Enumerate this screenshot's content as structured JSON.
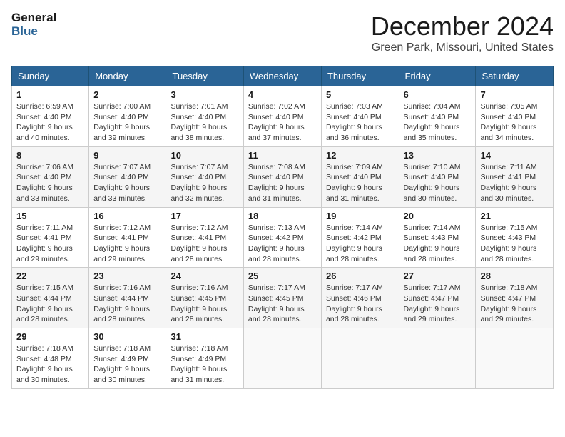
{
  "header": {
    "logo_line1": "General",
    "logo_line2": "Blue",
    "month": "December 2024",
    "location": "Green Park, Missouri, United States"
  },
  "weekdays": [
    "Sunday",
    "Monday",
    "Tuesday",
    "Wednesday",
    "Thursday",
    "Friday",
    "Saturday"
  ],
  "weeks": [
    [
      {
        "day": "1",
        "sunrise": "6:59 AM",
        "sunset": "4:40 PM",
        "daylight": "9 hours and 40 minutes."
      },
      {
        "day": "2",
        "sunrise": "7:00 AM",
        "sunset": "4:40 PM",
        "daylight": "9 hours and 39 minutes."
      },
      {
        "day": "3",
        "sunrise": "7:01 AM",
        "sunset": "4:40 PM",
        "daylight": "9 hours and 38 minutes."
      },
      {
        "day": "4",
        "sunrise": "7:02 AM",
        "sunset": "4:40 PM",
        "daylight": "9 hours and 37 minutes."
      },
      {
        "day": "5",
        "sunrise": "7:03 AM",
        "sunset": "4:40 PM",
        "daylight": "9 hours and 36 minutes."
      },
      {
        "day": "6",
        "sunrise": "7:04 AM",
        "sunset": "4:40 PM",
        "daylight": "9 hours and 35 minutes."
      },
      {
        "day": "7",
        "sunrise": "7:05 AM",
        "sunset": "4:40 PM",
        "daylight": "9 hours and 34 minutes."
      }
    ],
    [
      {
        "day": "8",
        "sunrise": "7:06 AM",
        "sunset": "4:40 PM",
        "daylight": "9 hours and 33 minutes."
      },
      {
        "day": "9",
        "sunrise": "7:07 AM",
        "sunset": "4:40 PM",
        "daylight": "9 hours and 33 minutes."
      },
      {
        "day": "10",
        "sunrise": "7:07 AM",
        "sunset": "4:40 PM",
        "daylight": "9 hours and 32 minutes."
      },
      {
        "day": "11",
        "sunrise": "7:08 AM",
        "sunset": "4:40 PM",
        "daylight": "9 hours and 31 minutes."
      },
      {
        "day": "12",
        "sunrise": "7:09 AM",
        "sunset": "4:40 PM",
        "daylight": "9 hours and 31 minutes."
      },
      {
        "day": "13",
        "sunrise": "7:10 AM",
        "sunset": "4:40 PM",
        "daylight": "9 hours and 30 minutes."
      },
      {
        "day": "14",
        "sunrise": "7:11 AM",
        "sunset": "4:41 PM",
        "daylight": "9 hours and 30 minutes."
      }
    ],
    [
      {
        "day": "15",
        "sunrise": "7:11 AM",
        "sunset": "4:41 PM",
        "daylight": "9 hours and 29 minutes."
      },
      {
        "day": "16",
        "sunrise": "7:12 AM",
        "sunset": "4:41 PM",
        "daylight": "9 hours and 29 minutes."
      },
      {
        "day": "17",
        "sunrise": "7:12 AM",
        "sunset": "4:41 PM",
        "daylight": "9 hours and 28 minutes."
      },
      {
        "day": "18",
        "sunrise": "7:13 AM",
        "sunset": "4:42 PM",
        "daylight": "9 hours and 28 minutes."
      },
      {
        "day": "19",
        "sunrise": "7:14 AM",
        "sunset": "4:42 PM",
        "daylight": "9 hours and 28 minutes."
      },
      {
        "day": "20",
        "sunrise": "7:14 AM",
        "sunset": "4:43 PM",
        "daylight": "9 hours and 28 minutes."
      },
      {
        "day": "21",
        "sunrise": "7:15 AM",
        "sunset": "4:43 PM",
        "daylight": "9 hours and 28 minutes."
      }
    ],
    [
      {
        "day": "22",
        "sunrise": "7:15 AM",
        "sunset": "4:44 PM",
        "daylight": "9 hours and 28 minutes."
      },
      {
        "day": "23",
        "sunrise": "7:16 AM",
        "sunset": "4:44 PM",
        "daylight": "9 hours and 28 minutes."
      },
      {
        "day": "24",
        "sunrise": "7:16 AM",
        "sunset": "4:45 PM",
        "daylight": "9 hours and 28 minutes."
      },
      {
        "day": "25",
        "sunrise": "7:17 AM",
        "sunset": "4:45 PM",
        "daylight": "9 hours and 28 minutes."
      },
      {
        "day": "26",
        "sunrise": "7:17 AM",
        "sunset": "4:46 PM",
        "daylight": "9 hours and 28 minutes."
      },
      {
        "day": "27",
        "sunrise": "7:17 AM",
        "sunset": "4:47 PM",
        "daylight": "9 hours and 29 minutes."
      },
      {
        "day": "28",
        "sunrise": "7:18 AM",
        "sunset": "4:47 PM",
        "daylight": "9 hours and 29 minutes."
      }
    ],
    [
      {
        "day": "29",
        "sunrise": "7:18 AM",
        "sunset": "4:48 PM",
        "daylight": "9 hours and 30 minutes."
      },
      {
        "day": "30",
        "sunrise": "7:18 AM",
        "sunset": "4:49 PM",
        "daylight": "9 hours and 30 minutes."
      },
      {
        "day": "31",
        "sunrise": "7:18 AM",
        "sunset": "4:49 PM",
        "daylight": "9 hours and 31 minutes."
      },
      null,
      null,
      null,
      null
    ]
  ],
  "labels": {
    "sunrise": "Sunrise:",
    "sunset": "Sunset:",
    "daylight": "Daylight:"
  }
}
